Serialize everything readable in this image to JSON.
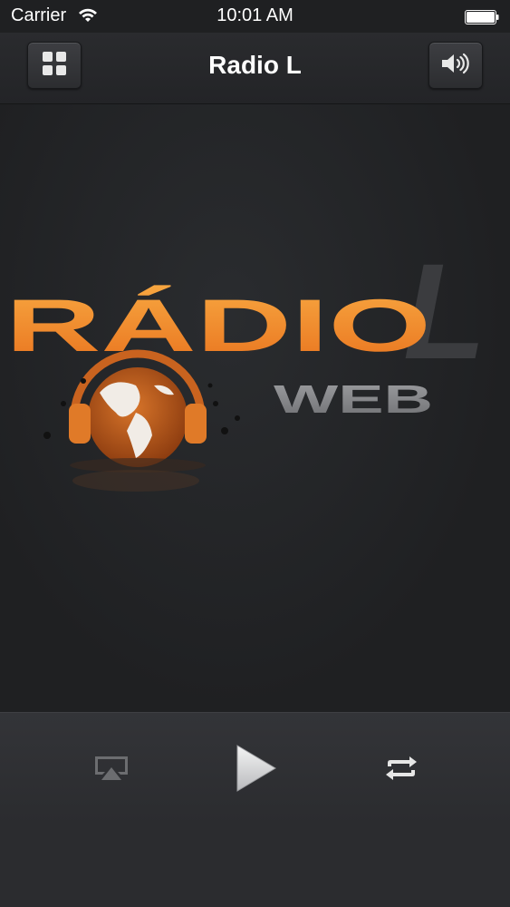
{
  "status_bar": {
    "carrier": "Carrier",
    "time": "10:01 AM"
  },
  "nav_bar": {
    "title": "Radio L",
    "left_icon": "grid-icon",
    "right_icon": "speaker-volume-icon"
  },
  "logo": {
    "main_text": "RÁDIO",
    "letter": "L",
    "sub_text": "WEB",
    "colors": {
      "orange": "#f08a26",
      "gray": "#8a8b8e"
    }
  },
  "player": {
    "airplay_icon": "airplay-icon",
    "play_icon": "play-icon",
    "repeat_icon": "repeat-icon"
  }
}
